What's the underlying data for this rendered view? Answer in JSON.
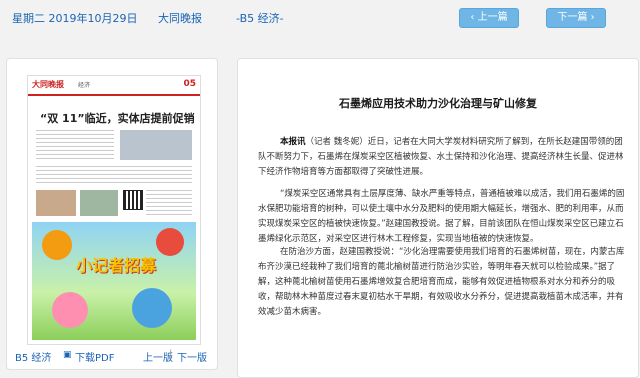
{
  "header": {
    "date": "星期二 2019年10月29日",
    "paper": "大同晚报",
    "section": "-B5 经济-",
    "prev_label": "上一篇",
    "next_label": "下一篇"
  },
  "thumbnail": {
    "logo": "大同晚报",
    "section": "经济",
    "page_no": "05",
    "headline": "“双 11”临近，实体店提前促销",
    "ad_title": "小记者招募"
  },
  "left_footer": {
    "section": "B5 经济",
    "download": "下载PDF",
    "prev": "上一版",
    "sep": "|",
    "next": "下一版"
  },
  "article": {
    "title": "石墨烯应用技术助力沙化治理与矿山修复",
    "p1_lead": "本报讯",
    "p1_text": "（记者 魏冬妮）近日，记者在大同大学炭材料研究所了解到，在所长赵建国带领的团队不断努力下，石墨烯在煤炭采空区植被恢复、水土保持和沙化治理、提高经济林生长量、促进林下经济作物培育等方面都取得了突破性进展。",
    "p2": "“煤炭采空区通常具有土层厚度薄、缺水严重等特点，普通植被难以成活，我们用石墨烯的固水保肥功能培育的树种，可以使土壤中水分及肥料的使用期大幅延长，增强水、肥的利用率，从而实现煤炭采空区的植被快速恢复。”赵建国教授说。据了解，目前该团队在恒山煤炭采空区已建立石墨烯绿化示范区，对采空区进行林木工程修复，实现当地植被的快速恢复。",
    "p3": "在防治沙方面，赵建国教授说：“沙化治理需要使用我们培育的石墨烯树苗，现在，内蒙古库布齐沙漠已经栽种了我们培育的蓖北榆树苗进行防治沙实验，等明年春天就可以检验成果。”据了解，这种蓖北榆树苗使用石墨烯增效复合肥培育而成，能够有效促进植物根系对水分和养分的吸收，帮助林木种苗度过春末夏初枯水干旱期，有效吸收水分养分，促进提高栽植苗木成活率，并有效减少苗木病害。"
  },
  "colors": {
    "link": "#1a64b4",
    "button": "#6fb6e6",
    "accent_red": "#c22"
  }
}
